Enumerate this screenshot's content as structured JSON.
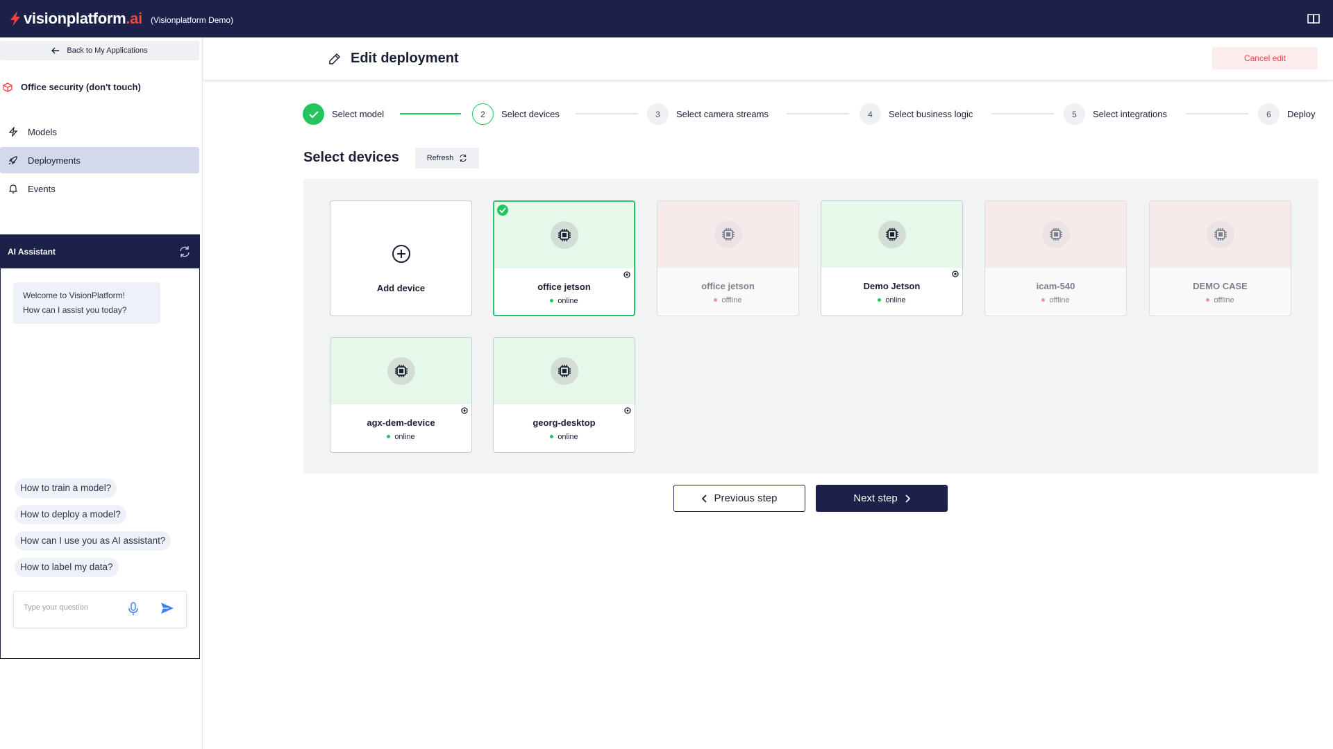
{
  "topbar": {
    "logo_main": "visionplatform",
    "logo_accent": ".ai",
    "org": "(Visionplatform Demo)",
    "docs_icon": "book-icon",
    "brand_color": "#1b2148",
    "accent_color": "#ef4444"
  },
  "sidebar": {
    "back_label": "Back to My Applications",
    "app_name": "Office security (don't touch)",
    "items": [
      {
        "label": "Models",
        "icon": "lightning-icon"
      },
      {
        "label": "Deployments",
        "icon": "rocket-icon",
        "active": true
      },
      {
        "label": "Events",
        "icon": "bell-icon"
      }
    ]
  },
  "assistant": {
    "title": "AI Assistant",
    "welcome_line1": "Welcome to VisionPlatform!",
    "welcome_line2": "How can I assist you today?",
    "suggestions": [
      "How to train a model?",
      "How to deploy a model?",
      "How can I use you as AI assistant?",
      "How to label my data?"
    ],
    "input_placeholder": "Type your question"
  },
  "header": {
    "title": "Edit deployment",
    "cancel_label": "Cancel edit"
  },
  "steps": [
    {
      "number": "1",
      "label": "Select model",
      "state": "done"
    },
    {
      "number": "2",
      "label": "Select devices",
      "state": "current"
    },
    {
      "number": "3",
      "label": "Select camera streams",
      "state": "upcoming"
    },
    {
      "number": "4",
      "label": "Select business logic",
      "state": "upcoming"
    },
    {
      "number": "5",
      "label": "Select integrations",
      "state": "upcoming"
    },
    {
      "number": "6",
      "label": "Deploy",
      "state": "upcoming"
    }
  ],
  "devices_section": {
    "title": "Select devices",
    "refresh_label": "Refresh",
    "add_label": "Add device",
    "devices": [
      {
        "name": "office jetson",
        "status": "online",
        "selected": true
      },
      {
        "name": "office jetson",
        "status": "offline",
        "selected": false
      },
      {
        "name": "Demo Jetson",
        "status": "online",
        "selected": false
      },
      {
        "name": "icam-540",
        "status": "offline",
        "selected": false
      },
      {
        "name": "DEMO CASE",
        "status": "offline",
        "selected": false
      },
      {
        "name": "agx-dem-device",
        "status": "online",
        "selected": false
      },
      {
        "name": "georg-desktop",
        "status": "online",
        "selected": false
      }
    ]
  },
  "footer": {
    "prev_label": "Previous step",
    "next_label": "Next step"
  },
  "colors": {
    "success": "#22c55e",
    "danger": "#ef4444",
    "online_bg": "#e6f8ea",
    "offline_bg": "#fbe3e3"
  }
}
